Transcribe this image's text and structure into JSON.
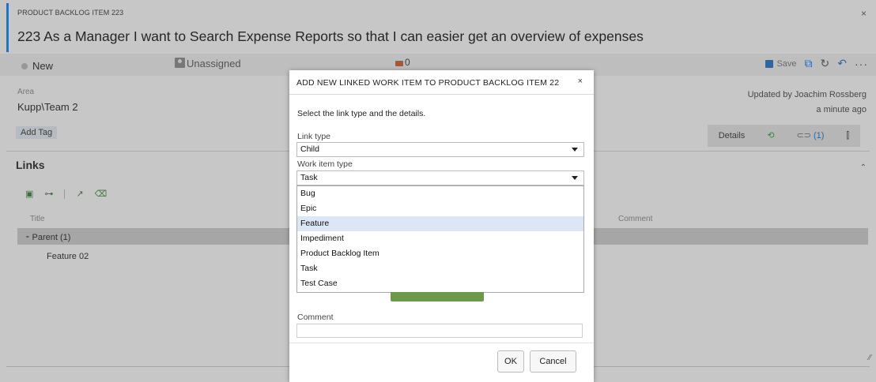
{
  "work_item": {
    "kind_label": "PRODUCT BACKLOG ITEM 223",
    "close_glyph": "×",
    "title": "223  As a Manager I want to Search Expense Reports so that I can easier get an overview of expenses",
    "state": "New",
    "assigned": "Unassigned",
    "comment_count": "0",
    "toolbar": {
      "save_label": "Save",
      "more_glyph": "···"
    },
    "area_label": "Area",
    "area_value": "Kupp\\Team 2",
    "add_tag_label": "Add Tag",
    "updated_by": "Updated by Joachim Rossberg",
    "updated_when": "a minute ago",
    "detail_tabs": {
      "details": "Details",
      "history_glyph": "⟲",
      "links": "⊂⊃ (1)",
      "attach_glyph": "⫿"
    }
  },
  "links_section": {
    "title": "Links",
    "col_title": "Title",
    "col_comment": "Comment",
    "parent_row": "⁃ Parent (1)",
    "child_item": "Feature 02"
  },
  "dialog": {
    "title": "ADD NEW LINKED WORK ITEM TO PRODUCT BACKLOG ITEM 22",
    "close_glyph": "×",
    "intro": "Select the link type and the details.",
    "link_type_label": "Link type",
    "link_type_value": "Child",
    "work_item_type_label": "Work item type",
    "work_item_type_value": "Task",
    "options": [
      "Bug",
      "Epic",
      "Feature",
      "Impediment",
      "Product Backlog Item",
      "Task",
      "Test Case"
    ],
    "highlighted_option": "Feature",
    "comment_label": "Comment",
    "ok_label": "OK",
    "cancel_label": "Cancel"
  },
  "colors": {
    "accent": "#1e7fd3",
    "comment_icon": "#d5572a",
    "tab_history": "#2f9a3f",
    "tab_links": "#1e70c1"
  },
  "icons": [
    "assign-icon",
    "comment-icon",
    "save-icon",
    "undo-icon",
    "refresh-icon",
    "redo-icon",
    "copy-icon",
    "history-icon",
    "link-icon",
    "attachment-icon"
  ]
}
